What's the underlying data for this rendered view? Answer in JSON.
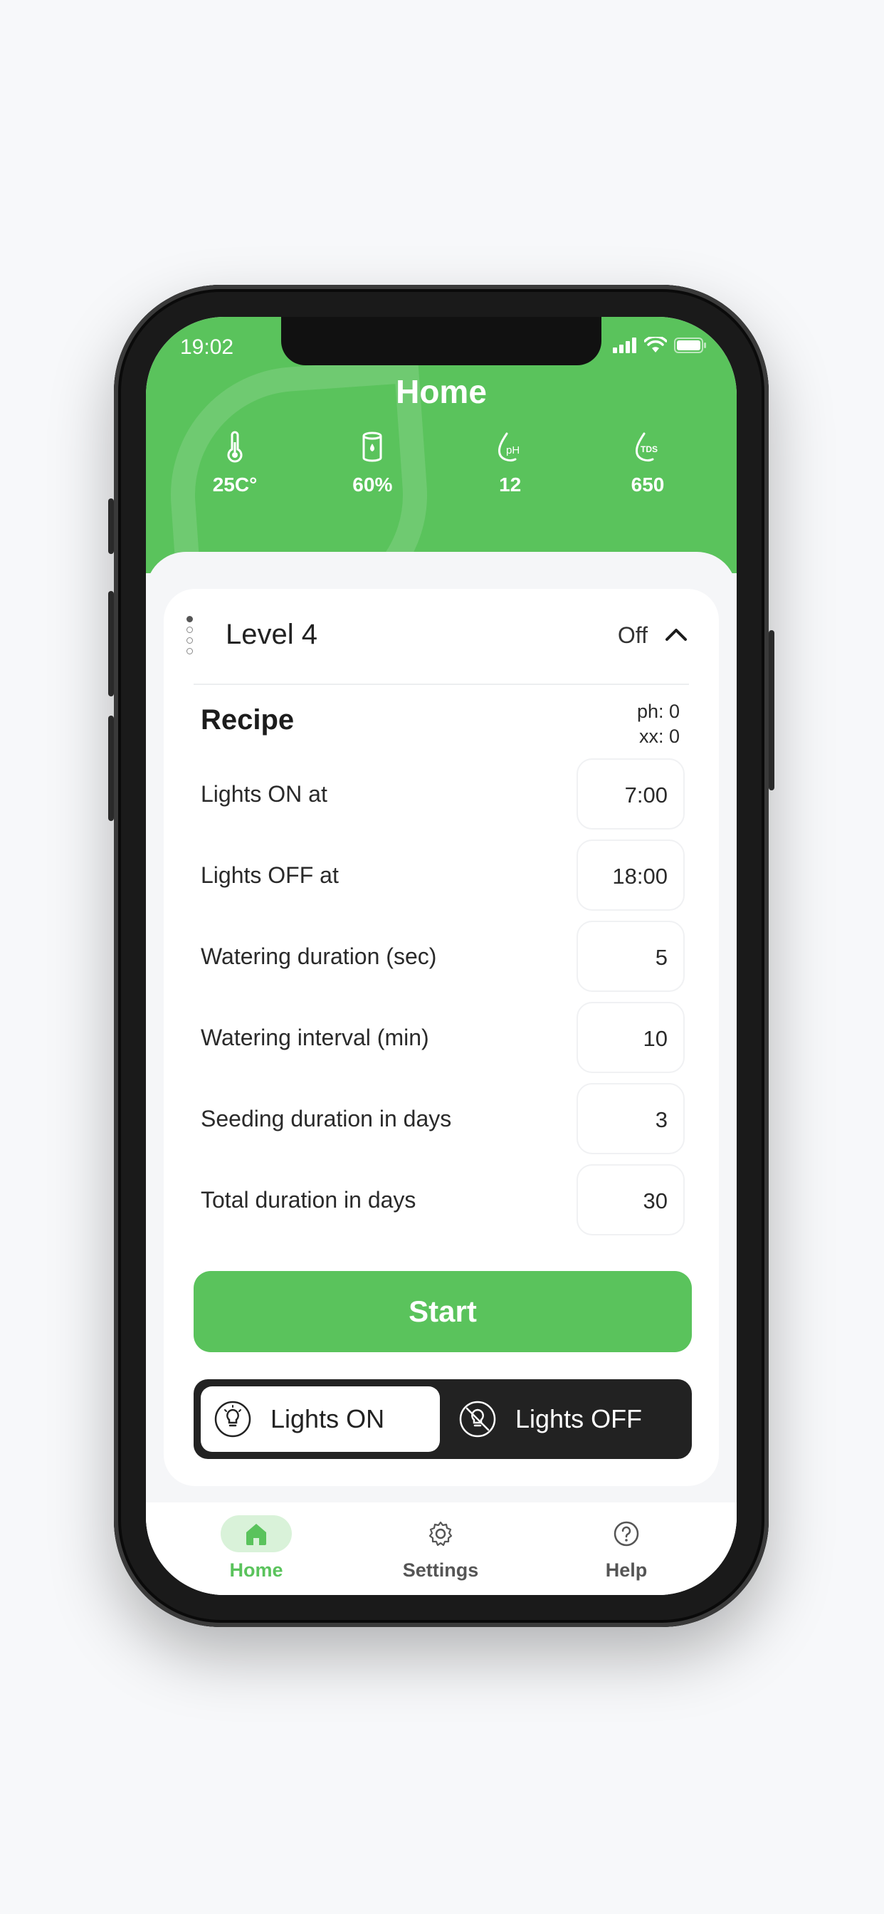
{
  "status_bar": {
    "time": "19:02"
  },
  "header": {
    "title": "Home",
    "stats": [
      {
        "icon": "thermometer-icon",
        "value": "25C°"
      },
      {
        "icon": "water-tank-icon",
        "value": "60%"
      },
      {
        "icon": "ph-drop-icon",
        "icon_text": "pH",
        "value": "12"
      },
      {
        "icon": "tds-drop-icon",
        "icon_text": "TDS",
        "value": "650"
      }
    ]
  },
  "level": {
    "label": "Level 4",
    "status": "Off"
  },
  "recipe": {
    "title": "Recipe",
    "ph": "ph: 0",
    "xx": "xx: 0",
    "rows": [
      {
        "label": "Lights ON at",
        "value": "7:00"
      },
      {
        "label": "Lights OFF at",
        "value": "18:00"
      },
      {
        "label": "Watering duration (sec)",
        "value": "5"
      },
      {
        "label": "Watering interval (min)",
        "value": "10"
      },
      {
        "label": "Seeding duration in days",
        "value": "3"
      },
      {
        "label": "Total duration in days",
        "value": "30"
      }
    ]
  },
  "actions": {
    "start_label": "Start",
    "lights_on_label": "Lights ON",
    "lights_off_label": "Lights OFF"
  },
  "nav": {
    "items": [
      {
        "label": "Home",
        "active": true
      },
      {
        "label": "Settings",
        "active": false
      },
      {
        "label": "Help",
        "active": false
      }
    ]
  },
  "colors": {
    "accent": "#5ac35c",
    "dark": "#222222"
  }
}
